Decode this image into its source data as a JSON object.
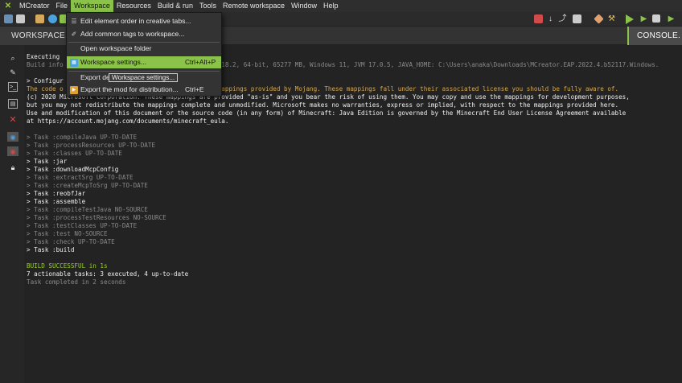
{
  "menubar": {
    "app": "MCreator",
    "items": [
      "File",
      "Workspace",
      "Resources",
      "Build & run",
      "Tools",
      "Remote workspace",
      "Window",
      "Help"
    ]
  },
  "tabs": {
    "workspace": "WORKSPACE",
    "console": "CONSOLE."
  },
  "dropdown": {
    "items": [
      {
        "label": "Edit element order in creative tabs...",
        "accel": "",
        "icon": "list-icon"
      },
      {
        "label": "Add common tags to workspace...",
        "accel": "",
        "icon": "tag-icon"
      },
      {
        "label": "Open workspace folder",
        "accel": "",
        "icon": ""
      },
      {
        "label": "Workspace settings...",
        "accel": "Ctrl+Alt+P",
        "icon": "settings-icon",
        "highlighted": true
      },
      {
        "label": "Export de",
        "accel": "",
        "icon": ""
      },
      {
        "label": "Export the mod for distribution...",
        "accel": "Ctrl+E",
        "icon": "export-icon"
      }
    ],
    "tooltip": "Workspace settings..."
  },
  "console": {
    "lines": [
      {
        "text": "Executing",
        "cls": "white"
      },
      {
        "text": "Build info                                        -1.18.2, 64-bit, 65277 MB, Windows 11, JVM 17.0.5, JAVA_HOME: C:\\Users\\anaka\\Downloads\\MCreator.EAP.2022.4.b52117.Windows.",
        "cls": "gray"
      },
      {
        "text": "",
        "cls": "blank"
      },
      {
        "text": "> Configur",
        "cls": "white"
      },
      {
        "text": "The code o                                        n mappings provided by Mojang. These mappings fall under their associated license you should be fully aware of.",
        "cls": "orange"
      },
      {
        "text": "(c) 2020 Microsoft Corporation. These mappings are provided \"as-is\" and you bear the risk of using them. You may copy and use the mappings for development purposes,",
        "cls": "white"
      },
      {
        "text": "but you may not redistribute the mappings complete and unmodified. Microsoft makes no warranties, express or implied, with respect to the mappings provided here.",
        "cls": "white"
      },
      {
        "text": "Use and modification of this document or the source code (in any form) of Minecraft: Java Edition is governed by the Minecraft End User License Agreement available",
        "cls": "white"
      },
      {
        "text": "at https://account.mojang.com/documents/minecraft_eula.",
        "cls": "white"
      },
      {
        "text": "",
        "cls": "blank"
      },
      {
        "text": "> Task :compileJava UP-TO-DATE",
        "cls": "gray"
      },
      {
        "text": "> Task :processResources UP-TO-DATE",
        "cls": "gray"
      },
      {
        "text": "> Task :classes UP-TO-DATE",
        "cls": "gray"
      },
      {
        "text": "> Task :jar",
        "cls": "white"
      },
      {
        "text": "> Task :downloadMcpConfig",
        "cls": "white"
      },
      {
        "text": "> Task :extractSrg UP-TO-DATE",
        "cls": "gray"
      },
      {
        "text": "> Task :createMcpToSrg UP-TO-DATE",
        "cls": "gray"
      },
      {
        "text": "> Task :reobfJar",
        "cls": "white"
      },
      {
        "text": "> Task :assemble",
        "cls": "white"
      },
      {
        "text": "> Task :compileTestJava NO-SOURCE",
        "cls": "gray"
      },
      {
        "text": "> Task :processTestResources NO-SOURCE",
        "cls": "gray"
      },
      {
        "text": "> Task :testClasses UP-TO-DATE",
        "cls": "gray"
      },
      {
        "text": "> Task :test NO-SOURCE",
        "cls": "gray"
      },
      {
        "text": "> Task :check UP-TO-DATE",
        "cls": "gray"
      },
      {
        "text": "> Task :build",
        "cls": "white"
      },
      {
        "text": "",
        "cls": "blank"
      },
      {
        "text": "BUILD SUCCESSFUL in 1s",
        "cls": "green"
      },
      {
        "text": "7 actionable tasks: 3 executed, 4 up-to-date",
        "cls": "white"
      },
      {
        "text": "Task completed in 2 seconds",
        "cls": "gray"
      }
    ]
  },
  "colors": {
    "accent": "#8bc34a",
    "background": "#232323",
    "warning_text": "#d9a648"
  }
}
